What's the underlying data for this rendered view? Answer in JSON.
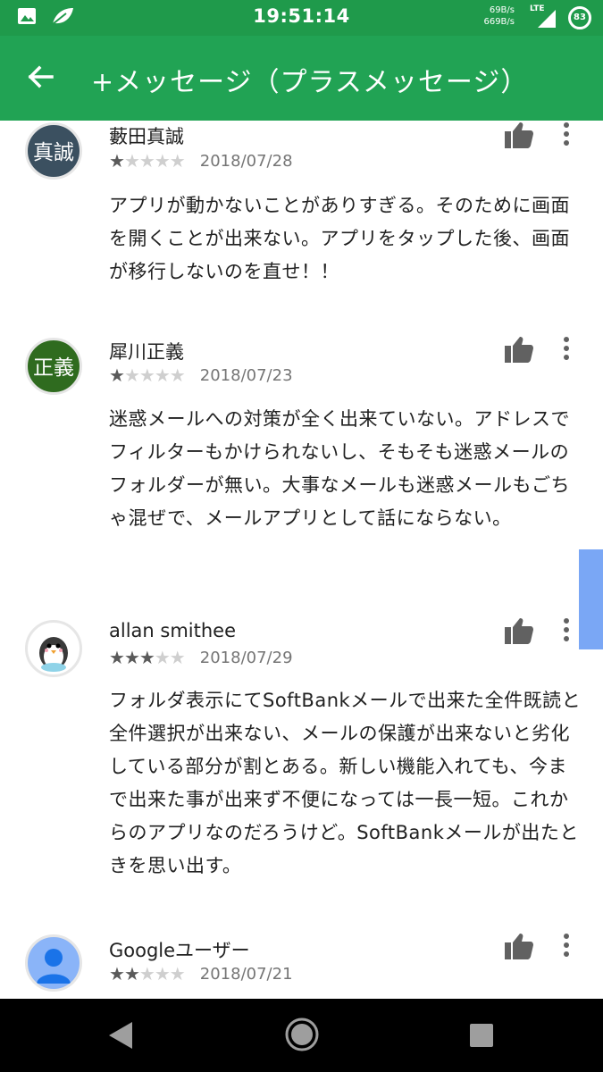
{
  "status_bar": {
    "time": "19:51:14",
    "net_up": "69B/s",
    "net_down": "669B/s",
    "network": "LTE",
    "battery": "83",
    "icons": [
      "image-icon",
      "leaf-icon",
      "signal-icon"
    ]
  },
  "app_bar": {
    "title": "+メッセージ（プラスメッセージ）",
    "back_icon": "arrow-left-icon"
  },
  "reviews": [
    {
      "avatar_text": "真誠",
      "avatar_color": "#3b5060",
      "name": "藪田真誠",
      "stars": 1,
      "date": "2018/07/28",
      "text": "アプリが動かないことがありすぎる。そのために画面を開くことが出来ない。アプリをタップした後、画面が移行しないのを直せ！！"
    },
    {
      "avatar_text": "正義",
      "avatar_color": "#2f6b1f",
      "name": "犀川正義",
      "stars": 1,
      "date": "2018/07/23",
      "text": "迷惑メールへの対策が全く出来ていない。アドレスでフィルターもかけられないし、そもそも迷惑メールのフォルダーが無い。大事なメールも迷惑メールもごちゃ混ぜで、メールアプリとして話にならない。"
    },
    {
      "avatar_text": "",
      "avatar_color": "#ffffff",
      "avatar_icon": "penguin-icon",
      "name": "allan smithee",
      "stars": 3,
      "date": "2018/07/29",
      "text": "フォルダ表示にてSoftBankメールで出来た全件既読と全件選択が出来ない、メールの保護が出来ないと劣化している部分が割とある。新しい機能入れても、今まで出来た事が出来ず不便になっては一長一短。これからのアプリなのだろうけど。SoftBankメールが出たときを思い出す。"
    },
    {
      "avatar_text": "",
      "avatar_color": "#8ab4f8",
      "avatar_icon": "person-icon",
      "name": "Googleユーザー",
      "stars": 2,
      "date": "2018/07/21",
      "text": ""
    }
  ],
  "nav_bar": {
    "buttons": [
      "back-triangle-icon",
      "home-circle-icon",
      "recents-square-icon"
    ]
  }
}
